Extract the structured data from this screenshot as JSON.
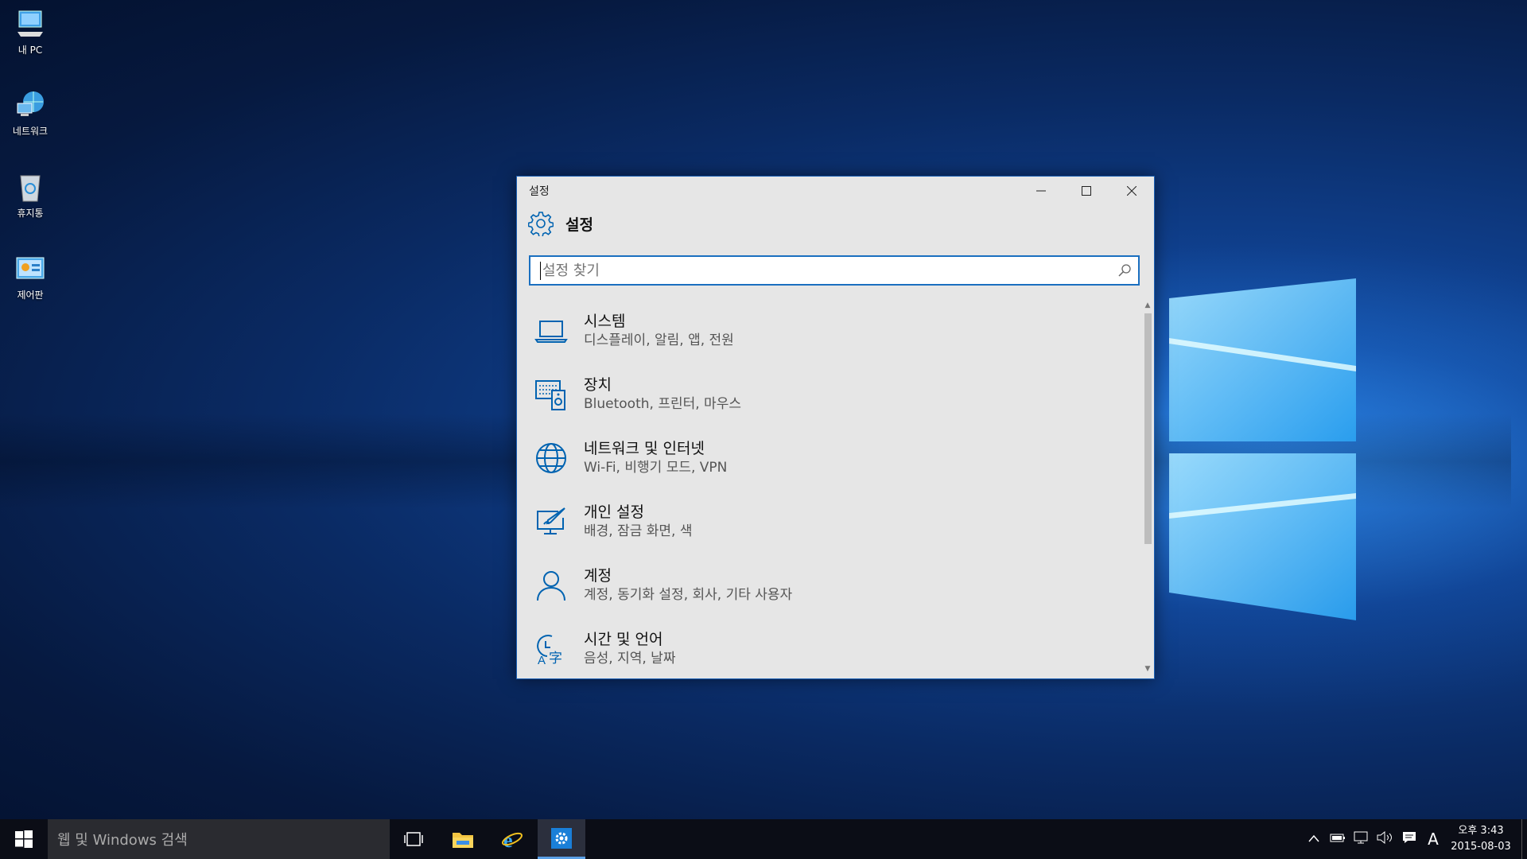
{
  "desktop": {
    "icons": [
      {
        "label": "내 PC",
        "icon": "pc-icon"
      },
      {
        "label": "네트워크",
        "icon": "network-icon"
      },
      {
        "label": "휴지통",
        "icon": "recycle-bin-icon"
      },
      {
        "label": "제어판",
        "icon": "control-panel-icon"
      }
    ]
  },
  "window": {
    "title": "설정",
    "header_title": "설정",
    "search_placeholder": "설정 찾기",
    "items": [
      {
        "title": "시스템",
        "subtitle": "디스플레이, 알림, 앱, 전원",
        "icon": "laptop-icon"
      },
      {
        "title": "장치",
        "subtitle": "Bluetooth, 프린터, 마우스",
        "icon": "devices-icon"
      },
      {
        "title": "네트워크 및 인터넷",
        "subtitle": "Wi-Fi, 비행기 모드, VPN",
        "icon": "globe-icon"
      },
      {
        "title": "개인 설정",
        "subtitle": "배경, 잠금 화면, 색",
        "icon": "personalization-icon"
      },
      {
        "title": "계정",
        "subtitle": "계정, 동기화 설정, 회사, 기타 사용자",
        "icon": "person-icon"
      },
      {
        "title": "시간 및 언어",
        "subtitle": "음성, 지역, 날짜",
        "icon": "time-language-icon"
      }
    ]
  },
  "taskbar": {
    "search_placeholder": "웹 및 Windows 검색",
    "ime": "A",
    "clock_time": "오후 3:43",
    "clock_date": "2015-08-03"
  },
  "colors": {
    "accent": "#0063b1",
    "window_bg": "#e6e6e6",
    "taskbar_bg": "#0b0d16"
  }
}
